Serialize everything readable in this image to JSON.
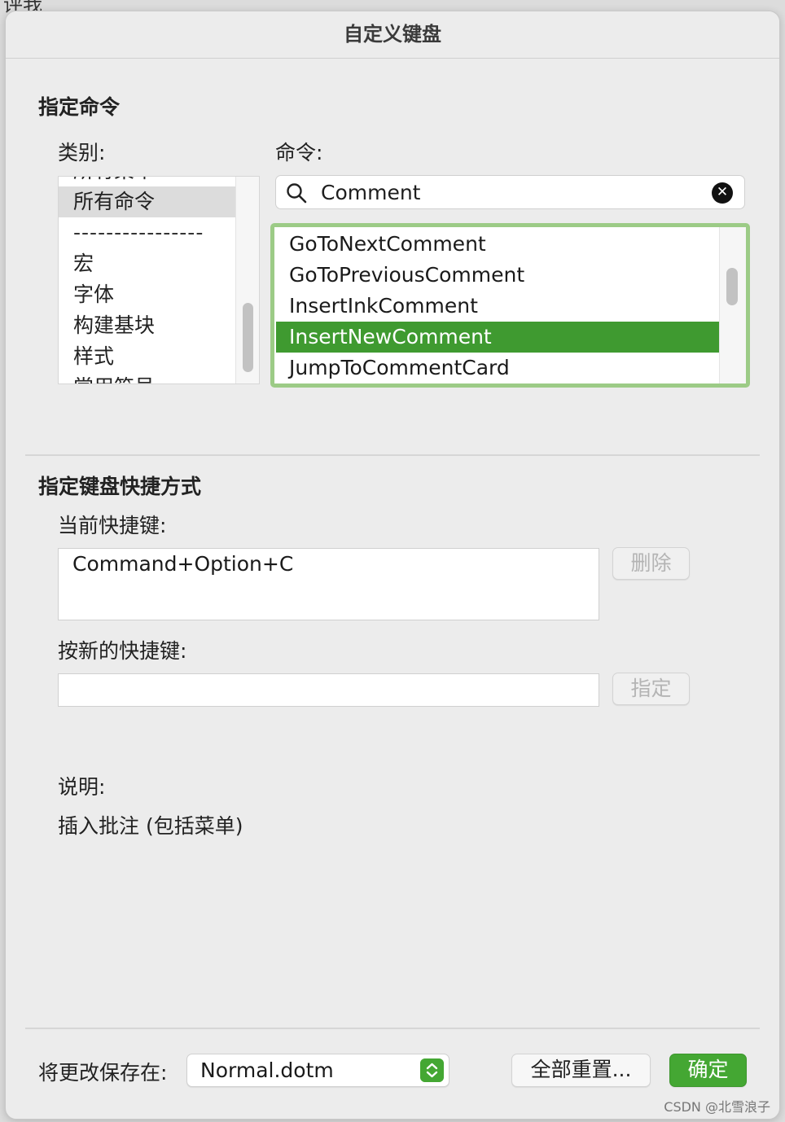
{
  "background": {
    "top_left_text": "评我"
  },
  "dialog": {
    "title": "自定义键盘",
    "assign_command": {
      "heading": "指定命令",
      "categories_label": "类别:",
      "commands_label": "命令:",
      "categories": [
        "所有菜单",
        "所有命令",
        "----------------",
        "宏",
        "字体",
        "构建基块",
        "样式",
        "常用符号"
      ],
      "selected_category": "所有命令",
      "search": {
        "value": "Comment",
        "clear_icon": "clear-icon"
      },
      "commands": [
        "GoToNextComment",
        "GoToPreviousComment",
        "InsertInkComment",
        "InsertNewComment",
        "JumpToCommentCard"
      ],
      "selected_command": "InsertNewComment"
    },
    "assign_shortcut": {
      "heading": "指定键盘快捷方式",
      "current_label": "当前快捷键:",
      "current_value": "Command+Option+C",
      "delete_button": "删除",
      "new_label": "按新的快捷键:",
      "new_value": "",
      "assign_button": "指定"
    },
    "description": {
      "label": "说明:",
      "text": "插入批注 (包括菜单)"
    },
    "footer": {
      "save_in_label": "将更改保存在:",
      "save_in_value": "Normal.dotm",
      "reset_all_button": "全部重置...",
      "ok_button": "确定"
    },
    "colors": {
      "accent": "#44a733",
      "selection": "#3f9a30",
      "focus_ring": "#9ccb86"
    }
  },
  "watermark": "CSDN @北雪浪子"
}
